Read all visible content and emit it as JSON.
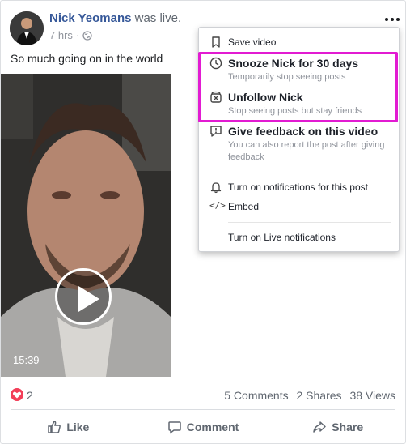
{
  "post": {
    "author": "Nick Yeomans",
    "verb": "was live.",
    "time": "7 hrs",
    "text": "So much going on in the world",
    "video_duration": "15:39"
  },
  "stats": {
    "reactions": "2",
    "comments": "5 Comments",
    "shares": "2 Shares",
    "views": "38 Views"
  },
  "actions": {
    "like": "Like",
    "comment": "Comment",
    "share": "Share"
  },
  "menu": {
    "save_video": "Save video",
    "snooze_title": "Snooze Nick for 30 days",
    "snooze_sub": "Temporarily stop seeing posts",
    "unfollow_title": "Unfollow Nick",
    "unfollow_sub": "Stop seeing posts but stay friends",
    "feedback_title": "Give feedback on this video",
    "feedback_sub": "You can also report the post after giving feedback",
    "notifications": "Turn on notifications for this post",
    "embed": "Embed",
    "live_notifications": "Turn on Live notifications"
  },
  "colors": {
    "author_link": "#365899",
    "highlight": "#e21bd2",
    "love_reaction": "#f33e58"
  }
}
